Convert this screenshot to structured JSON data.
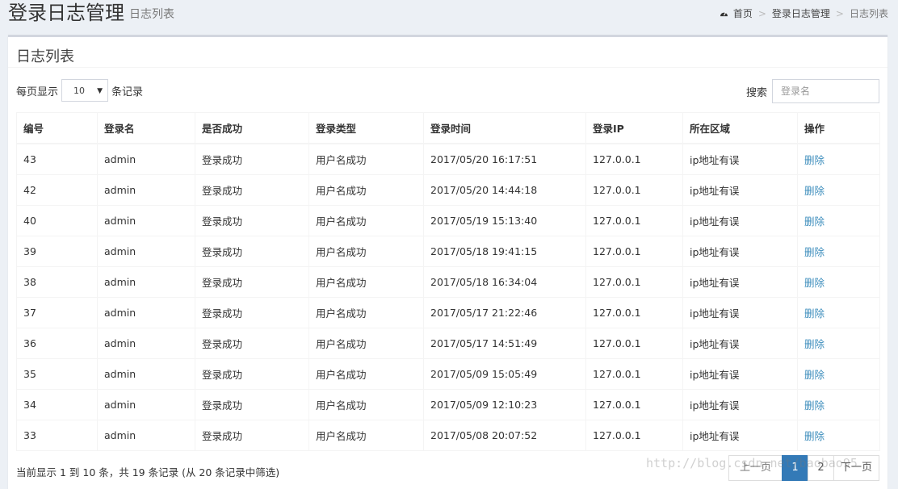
{
  "header": {
    "title": "登录日志管理",
    "subtitle": "日志列表"
  },
  "breadcrumb": {
    "icon": "dashboard-icon",
    "home": "首页",
    "section": "登录日志管理",
    "current": "日志列表",
    "separator": ">"
  },
  "box": {
    "title": "日志列表"
  },
  "length": {
    "prefix": "每页显示",
    "value": "10",
    "suffix": "条记录"
  },
  "search": {
    "label": "搜索",
    "placeholder": "登录名"
  },
  "table": {
    "columns": [
      "编号",
      "登录名",
      "是否成功",
      "登录类型",
      "登录时间",
      "登录IP",
      "所在区域",
      "操作"
    ],
    "rows": [
      {
        "id": "43",
        "name": "admin",
        "success": "登录成功",
        "type": "用户名成功",
        "time": "2017/05/20 16:17:51",
        "ip": "127.0.0.1",
        "region": "ip地址有误",
        "action": "删除"
      },
      {
        "id": "42",
        "name": "admin",
        "success": "登录成功",
        "type": "用户名成功",
        "time": "2017/05/20 14:44:18",
        "ip": "127.0.0.1",
        "region": "ip地址有误",
        "action": "删除"
      },
      {
        "id": "40",
        "name": "admin",
        "success": "登录成功",
        "type": "用户名成功",
        "time": "2017/05/19 15:13:40",
        "ip": "127.0.0.1",
        "region": "ip地址有误",
        "action": "删除"
      },
      {
        "id": "39",
        "name": "admin",
        "success": "登录成功",
        "type": "用户名成功",
        "time": "2017/05/18 19:41:15",
        "ip": "127.0.0.1",
        "region": "ip地址有误",
        "action": "删除"
      },
      {
        "id": "38",
        "name": "admin",
        "success": "登录成功",
        "type": "用户名成功",
        "time": "2017/05/18 16:34:04",
        "ip": "127.0.0.1",
        "region": "ip地址有误",
        "action": "删除"
      },
      {
        "id": "37",
        "name": "admin",
        "success": "登录成功",
        "type": "用户名成功",
        "time": "2017/05/17 21:22:46",
        "ip": "127.0.0.1",
        "region": "ip地址有误",
        "action": "删除"
      },
      {
        "id": "36",
        "name": "admin",
        "success": "登录成功",
        "type": "用户名成功",
        "time": "2017/05/17 14:51:49",
        "ip": "127.0.0.1",
        "region": "ip地址有误",
        "action": "删除"
      },
      {
        "id": "35",
        "name": "admin",
        "success": "登录成功",
        "type": "用户名成功",
        "time": "2017/05/09 15:05:49",
        "ip": "127.0.0.1",
        "region": "ip地址有误",
        "action": "删除"
      },
      {
        "id": "34",
        "name": "admin",
        "success": "登录成功",
        "type": "用户名成功",
        "time": "2017/05/09 12:10:23",
        "ip": "127.0.0.1",
        "region": "ip地址有误",
        "action": "删除"
      },
      {
        "id": "33",
        "name": "admin",
        "success": "登录成功",
        "type": "用户名成功",
        "time": "2017/05/08 20:07:52",
        "ip": "127.0.0.1",
        "region": "ip地址有误",
        "action": "删除"
      }
    ]
  },
  "info": "当前显示 1 到 10 条，共 19 条记录 (从 20 条记录中筛选)",
  "pager": {
    "prev": "上一页",
    "pages": [
      "1",
      "2"
    ],
    "active": "1",
    "next": "下一页"
  },
  "watermark": "http://blog.csdn.net/baobao95",
  "colors": {
    "link": "#3c8dbc",
    "active_page": "#337ab7",
    "background": "#ecf0f5"
  }
}
